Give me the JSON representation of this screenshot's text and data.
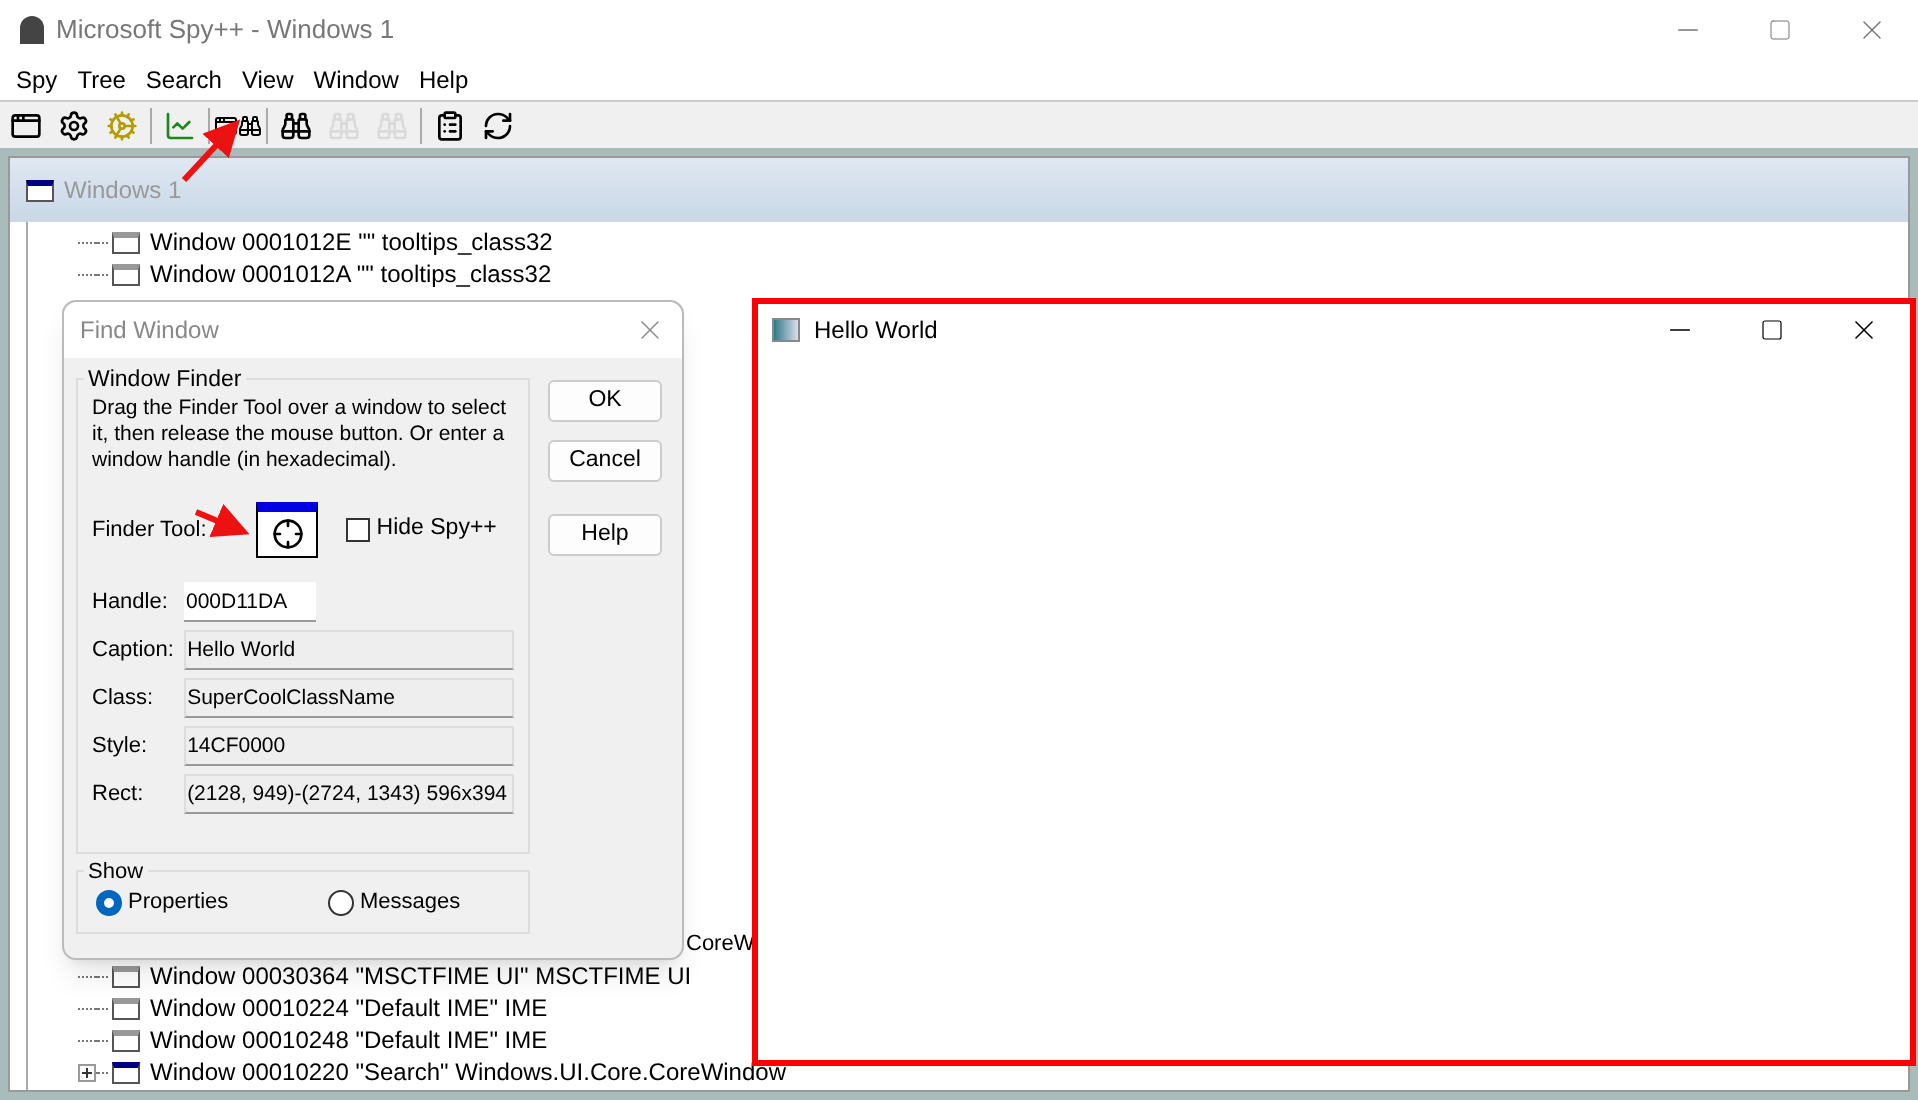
{
  "window": {
    "title": "Microsoft Spy++ - Windows 1"
  },
  "menu": [
    "Spy",
    "Tree",
    "Search",
    "View",
    "Window",
    "Help"
  ],
  "toolbar": [
    {
      "kind": "window",
      "disabled": false
    },
    {
      "kind": "gears",
      "disabled": false
    },
    {
      "kind": "gear",
      "disabled": false
    },
    {
      "kind": "chart",
      "disabled": false
    },
    {
      "kind": "find-window",
      "disabled": false
    },
    {
      "kind": "binoculars",
      "disabled": false
    },
    {
      "kind": "find-next",
      "disabled": true
    },
    {
      "kind": "find-prev",
      "disabled": true
    },
    {
      "kind": "properties",
      "disabled": false
    },
    {
      "kind": "refresh",
      "disabled": false
    }
  ],
  "child_window": {
    "title": "Windows 1",
    "active": false
  },
  "tree_top": [
    {
      "text": "Window 0001012E \"\" tooltips_class32",
      "kind": "leaf"
    },
    {
      "text": "Window 0001012A \"\" tooltips_class32",
      "kind": "leaf"
    }
  ],
  "tree_partial": "CoreW",
  "tree_bottom": [
    {
      "text": "Window 00030364 \"MSCTFIME UI\" MSCTFIME UI",
      "kind": "leaf"
    },
    {
      "text": "Window 00010224 \"Default IME\" IME",
      "kind": "leaf"
    },
    {
      "text": "Window 00010248 \"Default IME\" IME",
      "kind": "leaf"
    },
    {
      "text": "Window 00010220 \"Search\" Windows.UI.Core.CoreWindow",
      "kind": "expandable"
    }
  ],
  "find_dialog": {
    "title": "Find Window",
    "group": "Window Finder",
    "instructions": "Drag the Finder Tool over a window to select it, then release the mouse button.  Or enter a window handle (in hexadecimal).",
    "finder_label": "Finder Tool:",
    "hide_spy": {
      "label": "Hide Spy++",
      "checked": false
    },
    "fields": [
      {
        "label": "Handle:",
        "value": "000D11DA",
        "editable": true
      },
      {
        "label": "Caption:",
        "value": "Hello World",
        "editable": false
      },
      {
        "label": "Class:",
        "value": "SuperCoolClassName",
        "editable": false
      },
      {
        "label": "Style:",
        "value": "14CF0000",
        "editable": false
      },
      {
        "label": "Rect:",
        "value": "(2128, 949)-(2724, 1343) 596x394",
        "editable": false
      }
    ],
    "show_group": "Show",
    "show_options": [
      {
        "label": "Properties",
        "selected": true
      },
      {
        "label": "Messages",
        "selected": false
      }
    ],
    "buttons": [
      "OK",
      "Cancel",
      "Help"
    ]
  },
  "hello_window": {
    "title": "Hello World",
    "highlighted": true
  }
}
